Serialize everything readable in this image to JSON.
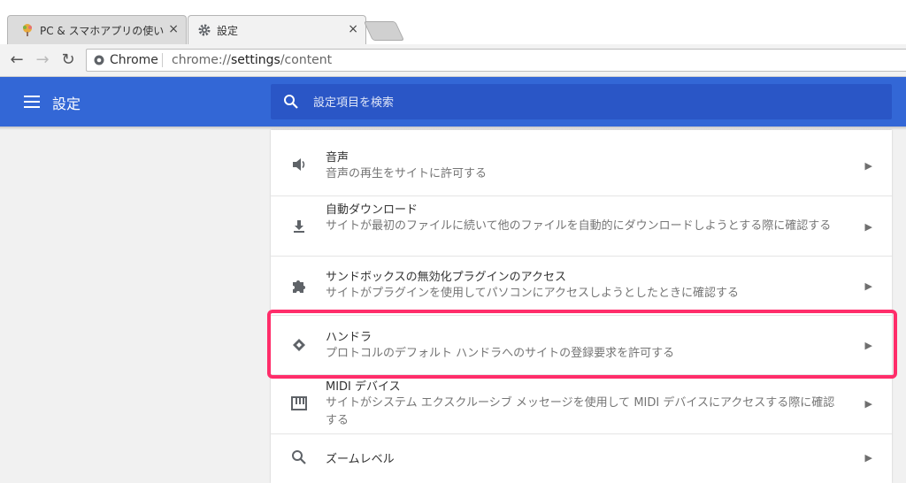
{
  "tabs": [
    {
      "title": "PC & スマホアプリの使い方",
      "close": "×",
      "icon": "tree-favicon"
    },
    {
      "title": "設定",
      "close": "×",
      "icon": "gear-icon"
    }
  ],
  "toolbar": {
    "back": "←",
    "forward": "→",
    "reload": "↻",
    "omnibox_scheme": "Chrome",
    "omnibox_url_pre": "chrome://",
    "omnibox_url_host": "settings",
    "omnibox_url_post": "/content"
  },
  "header": {
    "title": "設定",
    "search_placeholder": "設定項目を検索",
    "color": "#3367d6"
  },
  "rows": [
    {
      "label": "音声",
      "desc": "音声の再生をサイトに許可する",
      "icon": "speaker-icon"
    },
    {
      "label": "自動ダウンロード",
      "desc": "サイトが最初のファイルに続いて他のファイルを自動的にダウンロードしようとする際に確認する",
      "icon": "download-icon"
    },
    {
      "label": "サンドボックスの無効化プラグインのアクセス",
      "desc": "サイトがプラグインを使用してパソコンにアクセスしようとしたときに確認する",
      "icon": "puzzle-icon"
    },
    {
      "label": "ハンドラ",
      "desc": "プロトコルのデフォルト ハンドラへのサイトの登録要求を許可する",
      "icon": "handler-icon"
    },
    {
      "label": "MIDI デバイス",
      "desc": "サイトがシステム エクスクルーシブ メッセージを使用して MIDI デバイスにアクセスする際に確認する",
      "icon": "midi-icon"
    },
    {
      "label": "ズームレベル",
      "desc": "",
      "icon": "search-icon"
    }
  ],
  "chevron": "▶",
  "highlight_color": "#ff2d6a"
}
